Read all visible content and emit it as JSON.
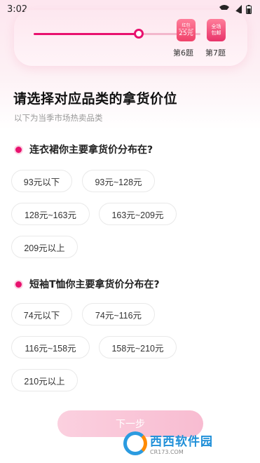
{
  "status_bar": {
    "time": "3:02"
  },
  "progress": {
    "value": 0.63,
    "rewards": [
      {
        "top": "红包",
        "value": "25元"
      },
      {
        "line1": "全场",
        "line2": "包邮"
      }
    ],
    "steps": [
      "第6题",
      "第7题"
    ]
  },
  "page": {
    "title": "请选择对应品类的拿货价位",
    "subtitle": "以下为当季市场热卖品类"
  },
  "questions": [
    {
      "text": "连衣裙你主要拿货价分布在?",
      "options": [
        "93元以下",
        "93元~128元",
        "128元~163元",
        "163元~209元",
        "209元以上"
      ]
    },
    {
      "text": "短袖T恤你主要拿货价分布在?",
      "options": [
        "74元以下",
        "74元~116元",
        "116元~158元",
        "158元~210元",
        "210元以上"
      ]
    }
  ],
  "footer": {
    "next_label": "下一步"
  },
  "watermark": {
    "main": "西西软件园",
    "sub": "CR173.COM"
  },
  "colors": {
    "accent": "#e8116e",
    "track": "#f3b7cc",
    "button": "#f8bcd1"
  }
}
